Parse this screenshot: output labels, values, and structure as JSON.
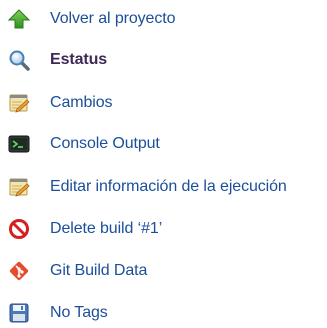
{
  "menu": {
    "items": [
      {
        "label": "Volver al proyecto",
        "icon": "green-up-arrow-icon"
      },
      {
        "label": "Estatus",
        "icon": "magnifier-icon",
        "active": true
      },
      {
        "label": "Cambios",
        "icon": "notepad-pencil-icon"
      },
      {
        "label": "Console Output",
        "icon": "terminal-icon"
      },
      {
        "label": "Editar información de la ejecución",
        "icon": "notepad-pencil-icon"
      },
      {
        "label": "Delete build ‘#1’",
        "icon": "no-entry-icon"
      },
      {
        "label": "Git Build Data",
        "icon": "git-logo-icon"
      },
      {
        "label": "No Tags",
        "icon": "floppy-disk-icon"
      }
    ]
  },
  "colors": {
    "link": "#1b4f9a",
    "active": "#3d2a55"
  }
}
